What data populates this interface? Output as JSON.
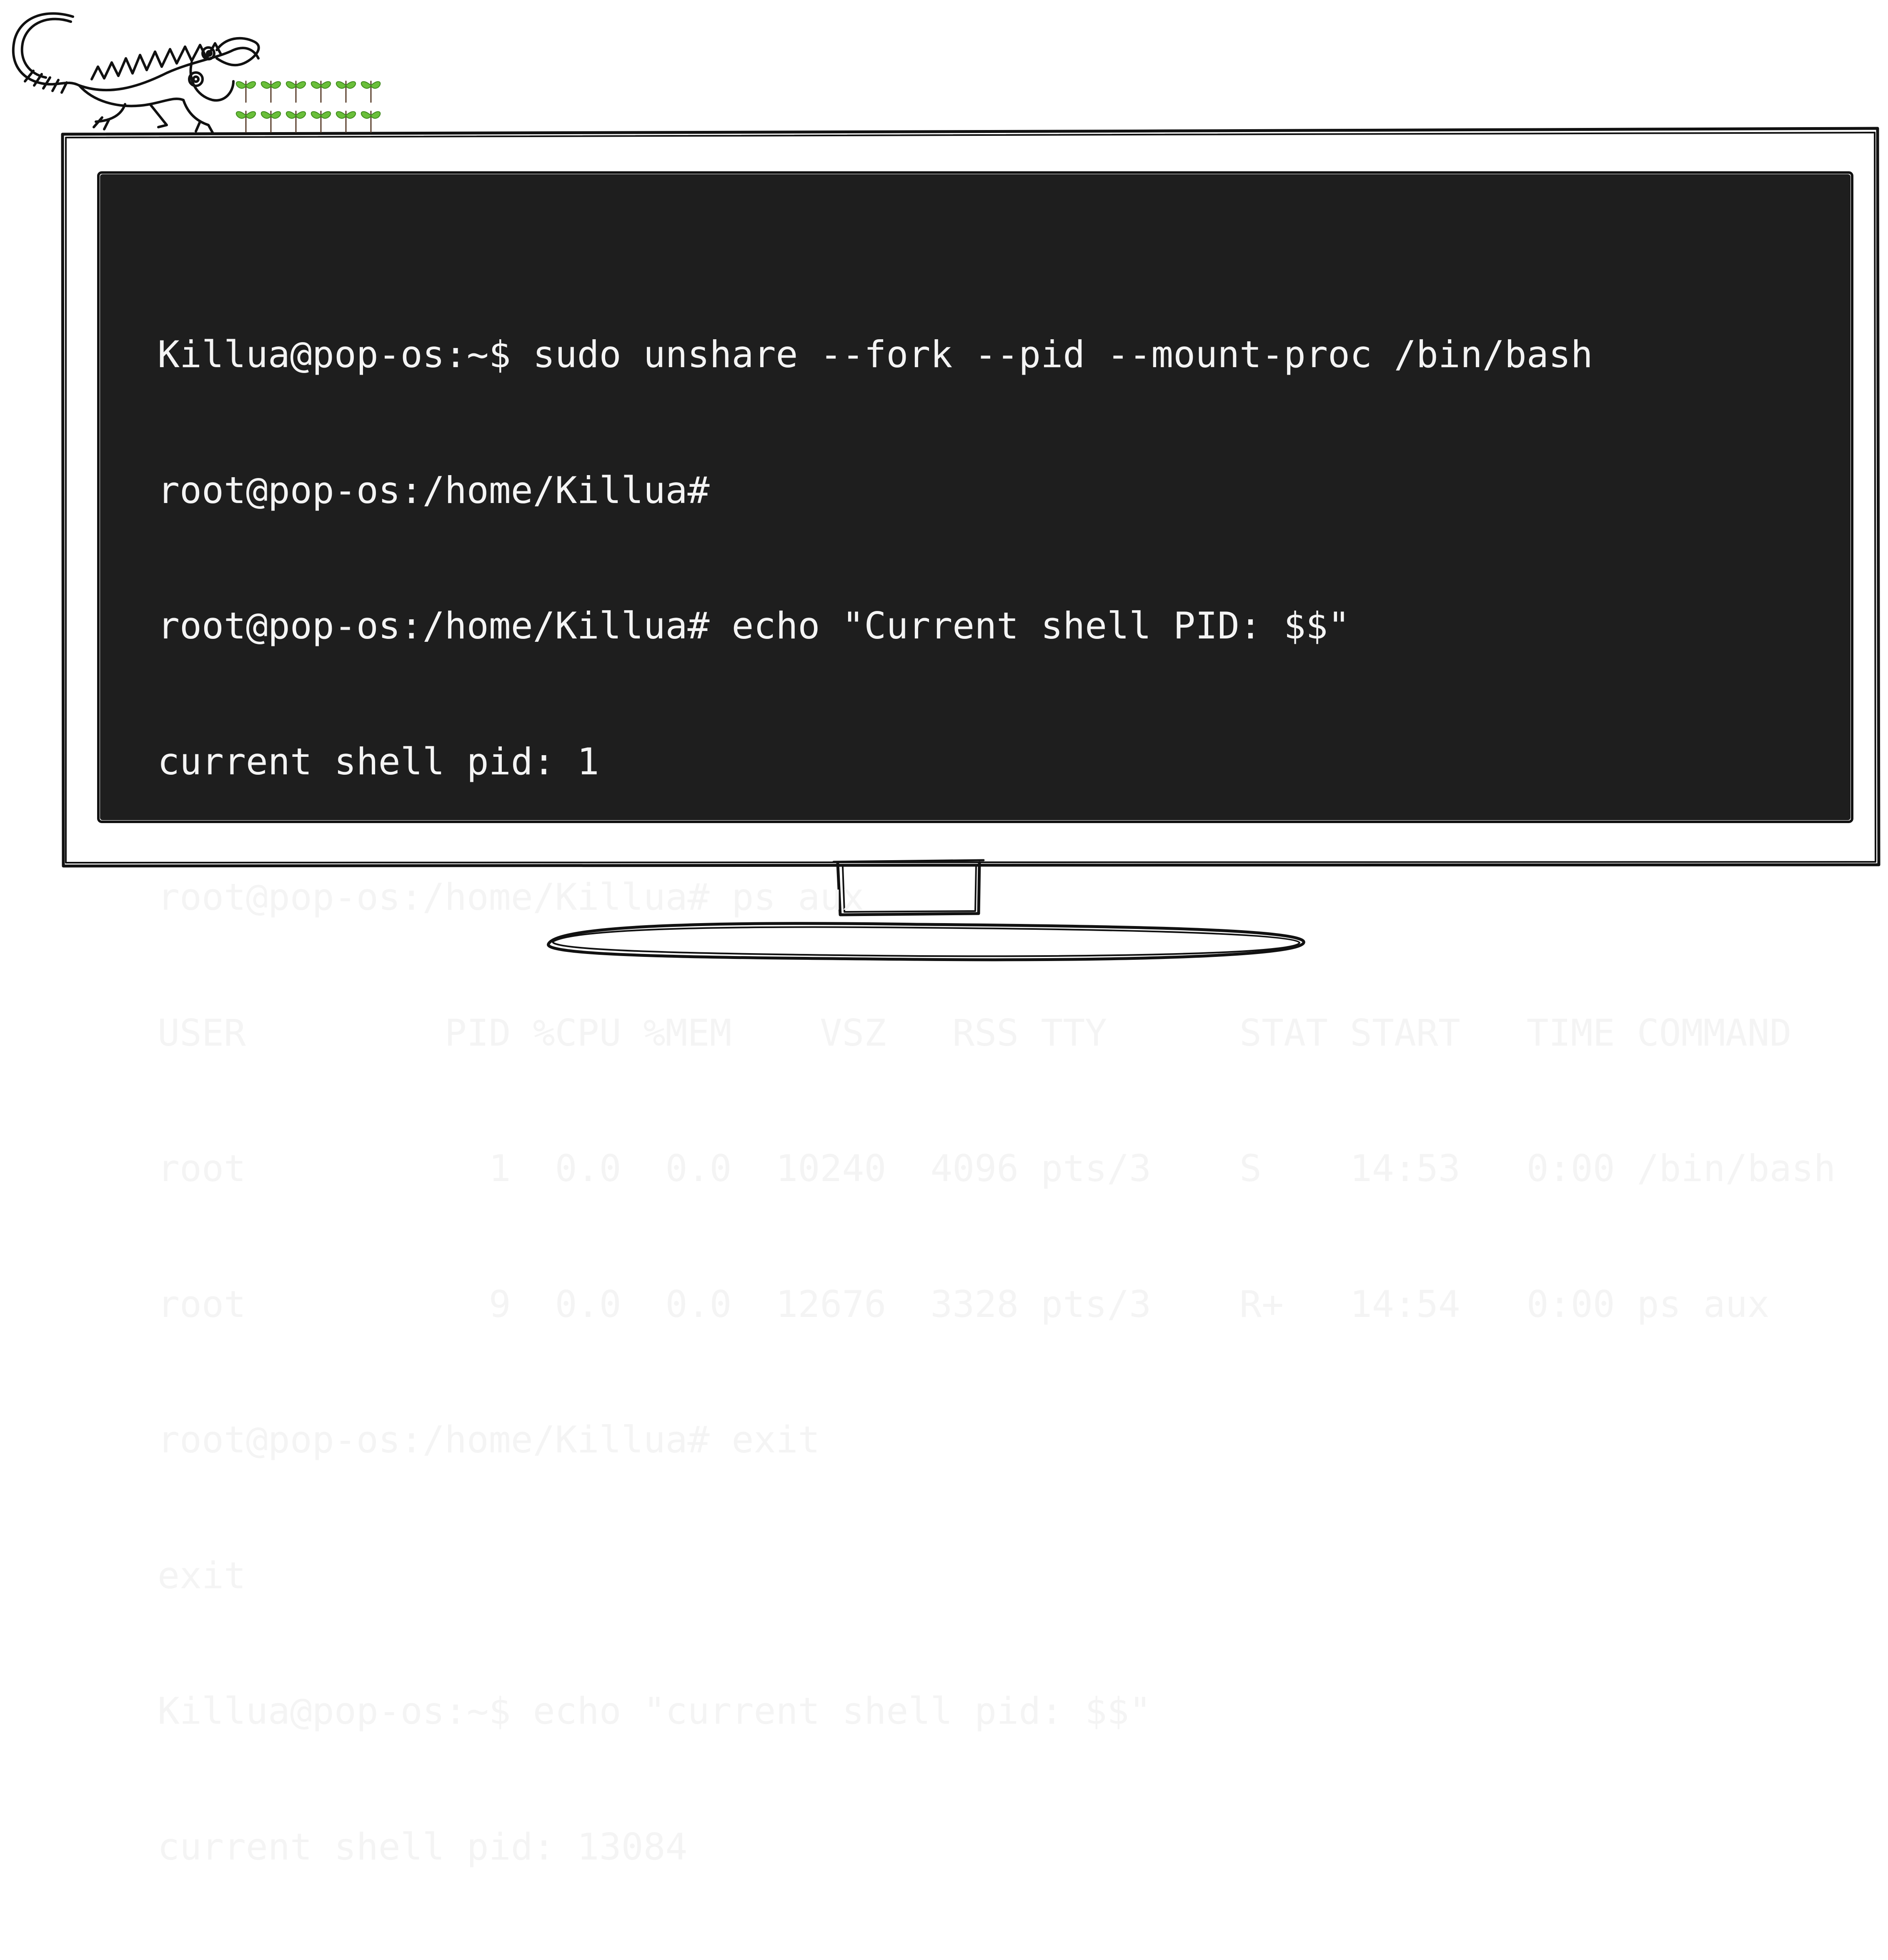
{
  "terminal": {
    "lines": [
      "Killua@pop-os:~$ sudo unshare --fork --pid --mount-proc /bin/bash",
      "root@pop-os:/home/Killua#",
      "root@pop-os:/home/Killua# echo \"Current shell PID: $$\"",
      "current shell pid: 1",
      "root@pop-os:/home/Killua# ps aux",
      "USER         PID %CPU %MEM    VSZ   RSS TTY      STAT START   TIME COMMAND",
      "root           1  0.0  0.0  10240  4096 pts/3    S    14:53   0:00 /bin/bash",
      "root           9  0.0  0.0  12676  3328 pts/3    R+   14:54   0:00 ps aux",
      "root@pop-os:/home/Killua# exit",
      "exit",
      "Killua@pop-os:~$ echo \"current shell pid: $$\"",
      "current shell pid: 13084"
    ]
  },
  "colors": {
    "screen_background": "#1e1e1e",
    "terminal_text": "#f4f4f4",
    "sketch_stroke": "#111111",
    "sprout_green": "#6abf3a"
  },
  "icons": {
    "mascot": "iguana-sketch-icon",
    "sprouts": "sprout-icon"
  }
}
